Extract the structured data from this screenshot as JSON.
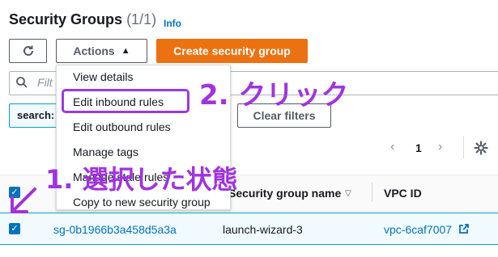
{
  "header": {
    "title": "Security Groups",
    "count": "(1/1)",
    "info_link": "Info"
  },
  "toolbar": {
    "refresh_icon": "refresh-icon",
    "actions_label": "Actions",
    "create_label": "Create security group"
  },
  "search": {
    "placeholder": "Filter security groups",
    "visible_placeholder": "Filt",
    "chip_label": "search:"
  },
  "filters": {
    "clear_label": "Clear filters"
  },
  "pagination": {
    "prev": "‹",
    "page": "1",
    "next": "›"
  },
  "actions_menu": {
    "items": [
      "View details",
      "Edit inbound rules",
      "Edit outbound rules",
      "Manage tags",
      "Manage stale rules",
      "Copy to new security group"
    ]
  },
  "table": {
    "headers": [
      "Security group name",
      "VPC ID"
    ],
    "rows": [
      {
        "selected": true,
        "id": "sg-0b1966b3a458d5a3a",
        "name": "launch-wizard-3",
        "vpc": "vpc-6caf7007"
      }
    ]
  },
  "annotations": {
    "step1": "1. 選択した状態",
    "step2": "2. クリック"
  },
  "colors": {
    "accent_orange": "#ec7211",
    "link_blue": "#0073bb",
    "annotation_purple": "#a033e0"
  }
}
